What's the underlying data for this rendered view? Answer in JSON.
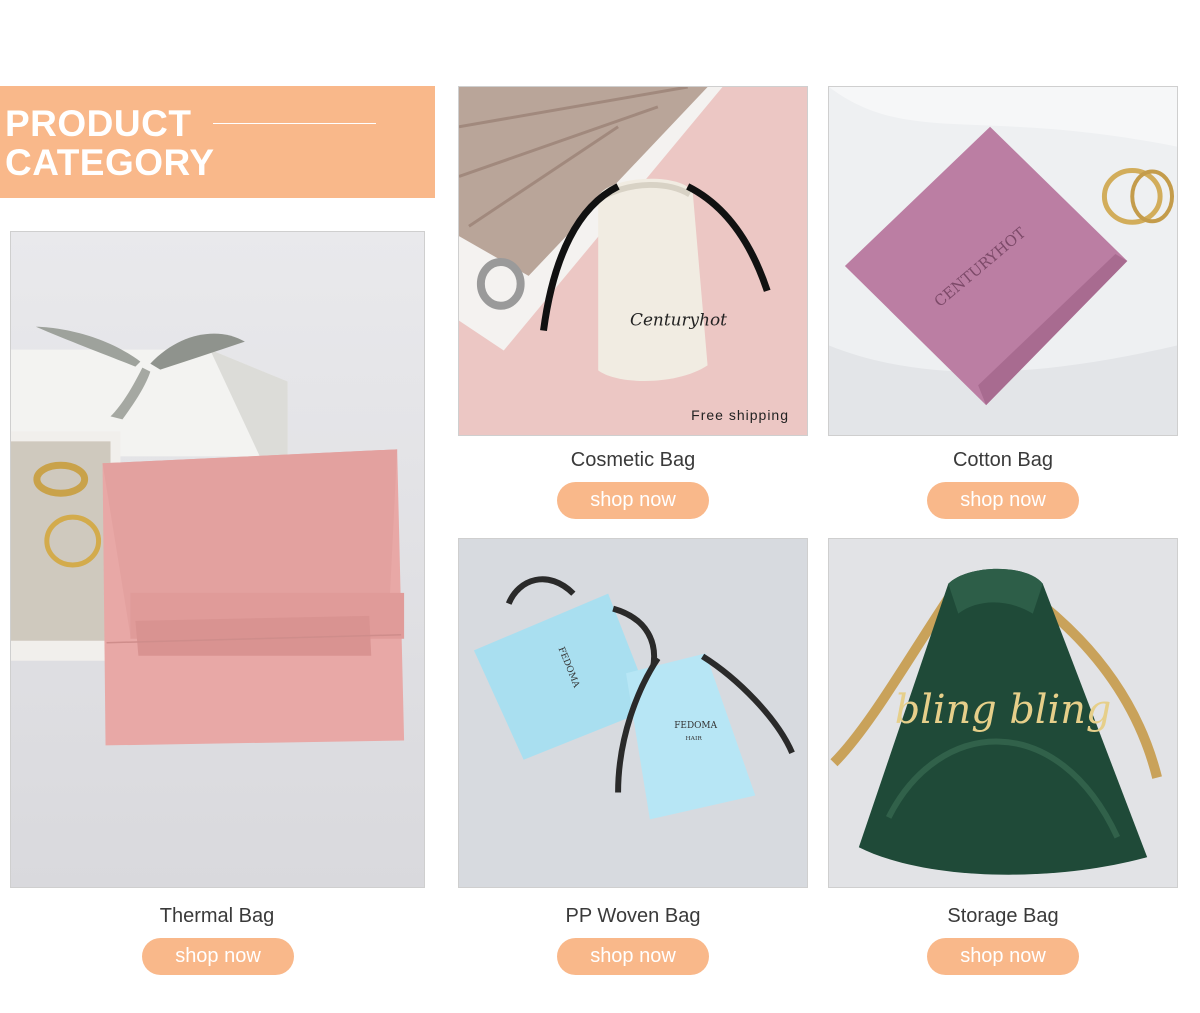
{
  "banner": {
    "title_line1": "PRODUCT",
    "title_line2": "CATEGORY"
  },
  "products": {
    "thermal": {
      "name": "Thermal Bag",
      "button": "shop now"
    },
    "cosmetic": {
      "name": "Cosmetic Bag",
      "button": "shop now",
      "badge": "Free shipping",
      "brand": "Centuryhot"
    },
    "cotton": {
      "name": "Cotton Bag",
      "button": "shop now",
      "brand": "CENTURYHOT"
    },
    "pp": {
      "name": "PP Woven Bag",
      "button": "shop now",
      "brand": "FEDOMA",
      "brand_sub": "HAIR"
    },
    "storage": {
      "name": "Storage Bag",
      "button": "shop now",
      "brand": "bling bling"
    }
  },
  "colors": {
    "accent": "#f9b88a"
  }
}
